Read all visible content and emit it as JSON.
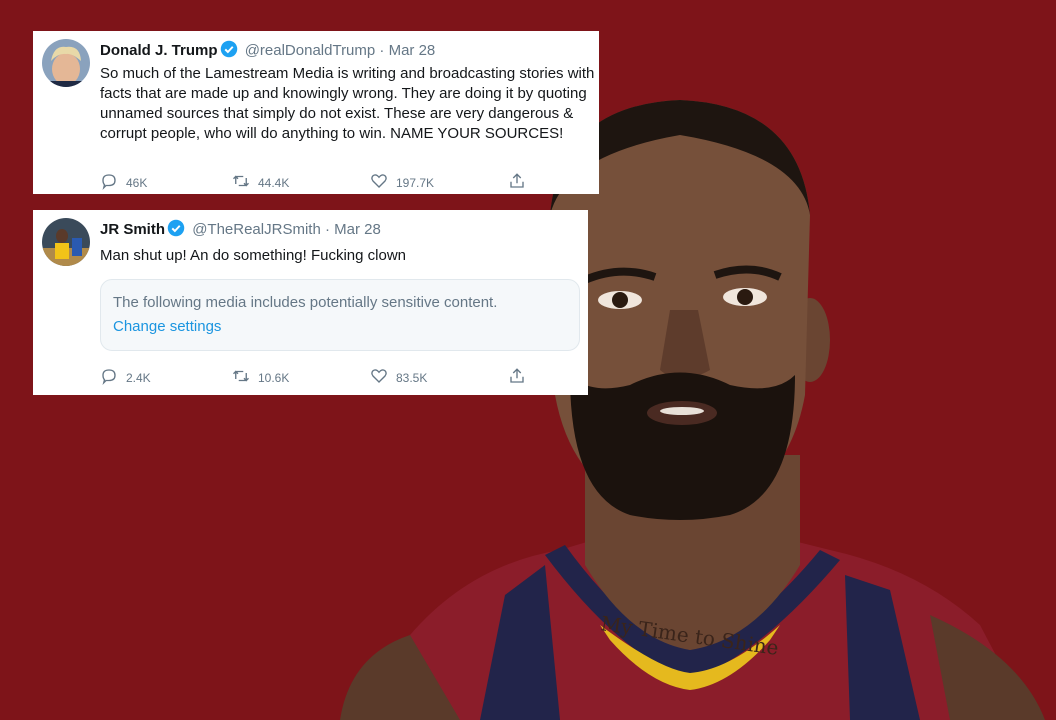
{
  "tweets": [
    {
      "name": "Donald J. Trump",
      "handle": "@realDonaldTrump",
      "separator": "·",
      "date": "Mar 28",
      "text": "So much of the Lamestream Media is writing and broadcasting stories with facts that are made up and knowingly wrong. They are doing it by quoting unnamed sources that simply do not exist. These are very dangerous & corrupt people, who will do anything to win. NAME YOUR SOURCES!",
      "replies": "46K",
      "retweets": "44.4K",
      "likes": "197.7K"
    },
    {
      "name": "JR Smith",
      "handle": "@TheRealJRSmith",
      "separator": "·",
      "date": "Mar 28",
      "text": "Man shut up! An do something! Fucking clown",
      "media_notice": "The following media includes potentially sensitive content.",
      "media_link": "Change settings",
      "replies": "2.4K",
      "retweets": "10.6K",
      "likes": "83.5K"
    }
  ],
  "colors": {
    "background": "#7e1419",
    "verified_blue": "#1da1f2",
    "muted_text": "#657786",
    "link": "#1b95e0"
  },
  "icons": [
    "verified-badge-icon",
    "reply-icon",
    "retweet-icon",
    "like-icon",
    "share-icon"
  ]
}
